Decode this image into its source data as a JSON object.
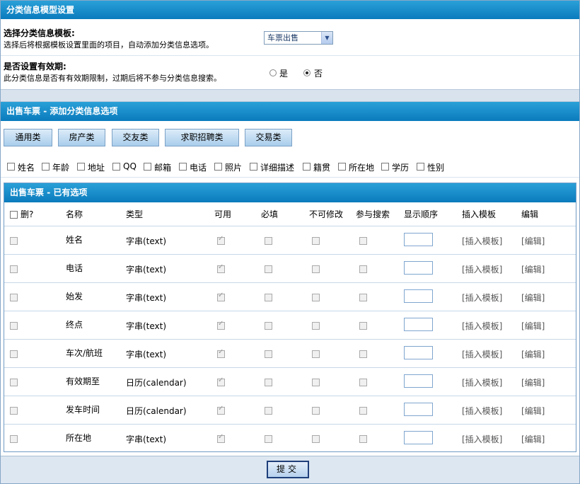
{
  "settings": {
    "title": "分类信息模型设置",
    "template_label": "选择分类信息模板:",
    "template_desc": "选择后将根据模板设置里面的项目，自动添加分类信息选项。",
    "template_value": "车票出售",
    "validity_label": "是否设置有效期:",
    "validity_desc": "此分类信息是否有有效期限制，过期后将不参与分类信息搜索。",
    "validity_yes": "是",
    "validity_no": "否",
    "validity_selected": "否"
  },
  "add_section": {
    "title_prefix": "出售车票",
    "title_suffix": "- 添加分类信息选项",
    "category_tabs": [
      "通用类",
      "房产类",
      "交友类",
      "求职招聘类",
      "交易类"
    ],
    "fields": [
      "姓名",
      "年龄",
      "地址",
      "QQ",
      "邮箱",
      "电话",
      "照片",
      "详细描述",
      "籍贯",
      "所在地",
      "学历",
      "性别"
    ]
  },
  "existing": {
    "title_prefix": "出售车票",
    "title_suffix": "- 已有选项",
    "headers": {
      "delete": "删?",
      "name": "名称",
      "type": "类型",
      "enabled": "可用",
      "required": "必填",
      "readonly": "不可修改",
      "search": "参与搜索",
      "order": "显示顺序",
      "insert": "插入模板",
      "edit": "编辑"
    },
    "rows": [
      {
        "name": "姓名",
        "type": "字串(text)"
      },
      {
        "name": "电话",
        "type": "字串(text)"
      },
      {
        "name": "始发",
        "type": "字串(text)"
      },
      {
        "name": "终点",
        "type": "字串(text)"
      },
      {
        "name": "车次/航班",
        "type": "字串(text)"
      },
      {
        "name": "有效期至",
        "type": "日历(calendar)"
      },
      {
        "name": "发车时间",
        "type": "日历(calendar)"
      },
      {
        "name": "所在地",
        "type": "字串(text)"
      }
    ],
    "insert_link": "[插入模板]",
    "edit_link": "[编辑]"
  },
  "submit_label": "提交"
}
